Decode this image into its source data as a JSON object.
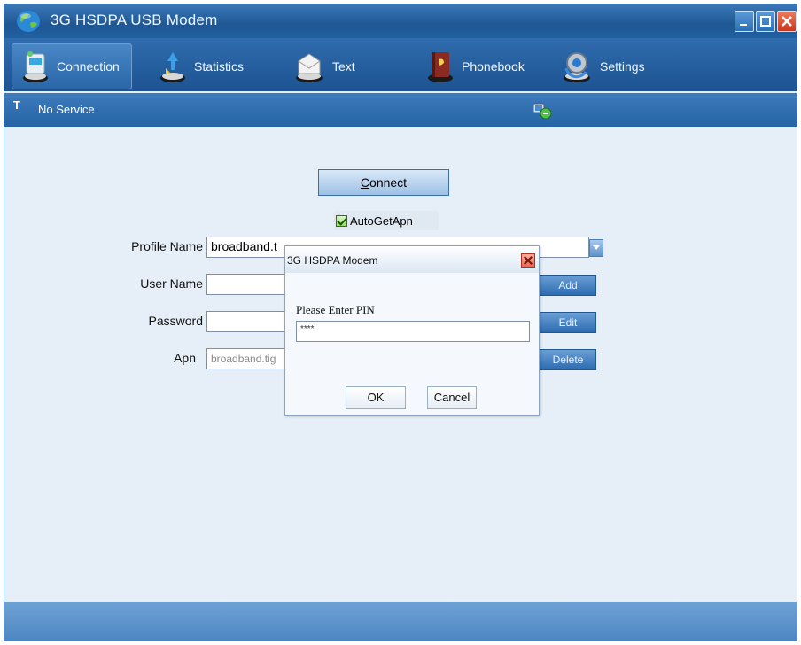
{
  "window": {
    "title": "3G HSDPA USB Modem"
  },
  "toolbar": {
    "items": [
      {
        "label": "Connection",
        "icon": "connection-icon",
        "active": true
      },
      {
        "label": "Statistics",
        "icon": "statistics-icon"
      },
      {
        "label": "Text",
        "icon": "text-message-icon"
      },
      {
        "label": "Phonebook",
        "icon": "phonebook-icon"
      },
      {
        "label": "Settings",
        "icon": "settings-icon"
      }
    ]
  },
  "status": {
    "signal_glyph": "T",
    "text": "No Service",
    "network_icon": "network-status-icon"
  },
  "connect": {
    "label_prefix": "",
    "label_accel": "C",
    "label_rest": "onnect"
  },
  "auto_get_apn": {
    "label": "AutoGetApn",
    "checked": true
  },
  "form": {
    "profile_name_label": "Profile Name",
    "profile_name_value": "broadband.t",
    "user_name_label": "User Name",
    "user_name_value": "",
    "password_label": "Password",
    "password_value": "",
    "apn_label": "Apn",
    "apn_value": "broadband.tig"
  },
  "buttons": {
    "add": "Add",
    "edit": "Edit",
    "delete": "Delete"
  },
  "dialog": {
    "title": "3G HSDPA Modem",
    "prompt": "Please Enter PIN",
    "pin_value": "****",
    "ok": "OK",
    "cancel": "Cancel"
  },
  "colors": {
    "titlebar": "#1f5794",
    "content_bg": "#e6eff8",
    "footer": "#5a90c8"
  }
}
